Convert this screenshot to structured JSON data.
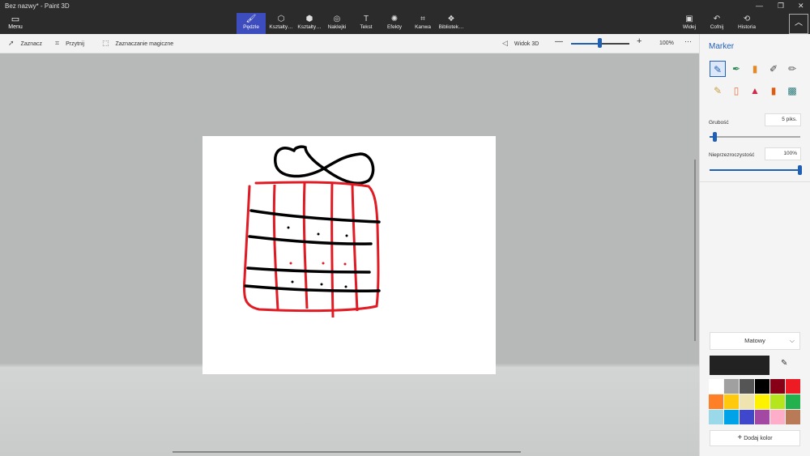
{
  "window": {
    "title": "Bez nazwy* - Paint 3D"
  },
  "menu": {
    "label": "Menu"
  },
  "ribbon_tools": [
    {
      "label": "Pędzle",
      "icon": "brush-icon",
      "glyph": "🖌"
    },
    {
      "label": "Kształty…",
      "icon": "shapes-2d-icon",
      "glyph": "⬡"
    },
    {
      "label": "Kształty…",
      "icon": "shapes-3d-icon",
      "glyph": "⬢"
    },
    {
      "label": "Naklejki",
      "icon": "stickers-icon",
      "glyph": "◎"
    },
    {
      "label": "Tekst",
      "icon": "text-icon",
      "glyph": "T"
    },
    {
      "label": "Efekty",
      "icon": "effects-icon",
      "glyph": "✺"
    },
    {
      "label": "Kanwa",
      "icon": "canvas-icon",
      "glyph": "⌗"
    },
    {
      "label": "Bibliotek…",
      "icon": "library-icon",
      "glyph": "❖"
    }
  ],
  "right_tools": [
    {
      "label": "Widej",
      "icon": "view-icon",
      "glyph": "▣"
    },
    {
      "label": "Cofnij",
      "icon": "undo-icon",
      "glyph": "↶"
    },
    {
      "label": "Historia",
      "icon": "history-icon",
      "glyph": "⟲"
    }
  ],
  "toolbar2": {
    "select": "Zaznacz",
    "crop": "Przytnij",
    "magic_select": "Zaznaczanie magiczne",
    "view3d": "Widok 3D",
    "zoom": "100%",
    "zoom_fraction": 0.5
  },
  "panel": {
    "title": "Marker",
    "thickness_label": "Grubość",
    "thickness_value": "5 piks.",
    "thickness_fraction": 0.05,
    "opacity_label": "Nieprzezroczystość",
    "opacity_value": "100%",
    "opacity_fraction": 1.0,
    "finish": "Matowy",
    "current_color": "#222222",
    "add_color": "Dodaj kolor",
    "brushes": [
      {
        "icon": "marker-icon",
        "glyph": "✎",
        "color": "#1f5fb4",
        "selected": true
      },
      {
        "icon": "calligraphy-pen-icon",
        "glyph": "✒",
        "color": "#2e8b57",
        "selected": false
      },
      {
        "icon": "oil-brush-icon",
        "glyph": "▮",
        "color": "#e08a2a",
        "selected": false
      },
      {
        "icon": "watercolor-icon",
        "glyph": "✐",
        "color": "#444444",
        "selected": false
      },
      {
        "icon": "pixel-pen-icon",
        "glyph": "✏",
        "color": "#555555",
        "selected": false
      },
      {
        "icon": "pencil-icon",
        "glyph": "✎",
        "color": "#c8a048",
        "selected": false
      },
      {
        "icon": "eraser-icon",
        "glyph": "▯",
        "color": "#e07040",
        "selected": false
      },
      {
        "icon": "crayon-icon",
        "glyph": "▲",
        "color": "#d02a4a",
        "selected": false
      },
      {
        "icon": "spray-can-icon",
        "glyph": "▮",
        "color": "#e05a10",
        "selected": false
      },
      {
        "icon": "fill-bucket-icon",
        "glyph": "▩",
        "color": "#2a7a7a",
        "selected": false
      }
    ],
    "palette": [
      "#ffffff",
      "#a0a0a0",
      "#555555",
      "#000000",
      "#880015",
      "#ed1c24",
      "#ff7f27",
      "#ffc90e",
      "#efe4b0",
      "#fff200",
      "#b5e61d",
      "#22b14c",
      "#99d9ea",
      "#00a2e8",
      "#3f48cc",
      "#a349a4",
      "#ffaec9",
      "#b97a57"
    ]
  }
}
